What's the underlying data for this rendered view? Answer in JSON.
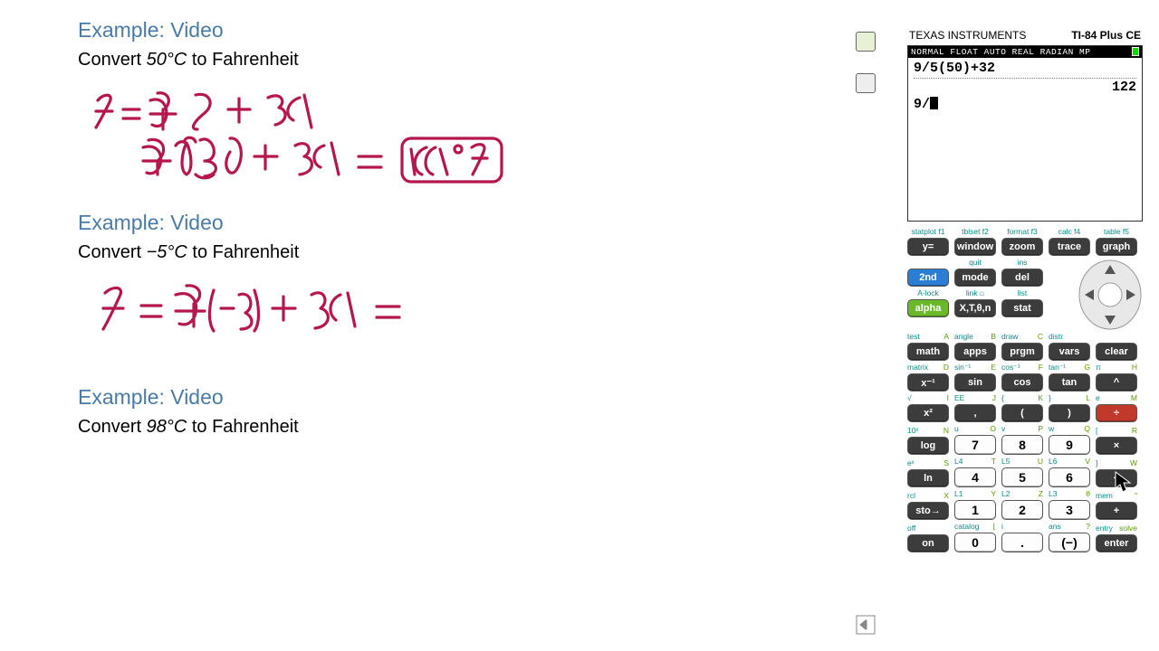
{
  "doc": {
    "ex1_title": "Example: Video",
    "ex1_prompt_a": "Convert ",
    "ex1_value": "50°C",
    "ex1_prompt_b": " to Fahrenheit",
    "ex2_title": "Example: Video",
    "ex2_prompt_a": "Convert ",
    "ex2_value": "−5°C",
    "ex2_prompt_b": " to Fahrenheit",
    "ex3_title": "Example: Video",
    "ex3_prompt_a": "Convert ",
    "ex3_value": "98°C",
    "ex3_prompt_b": " to Fahrenheit"
  },
  "calc": {
    "brand": "TEXAS INSTRUMENTS",
    "model": "TI-84 Plus CE",
    "status": "NORMAL FLOAT AUTO REAL RADIAN MP",
    "line1": "9/5(50)+32",
    "answer": "122",
    "line2": "9/",
    "f_labels": [
      "statplot  f1",
      "tblset  f2",
      "format  f3",
      "calc  f4",
      "table  f5"
    ],
    "f_keys": [
      "y=",
      "window",
      "zoom",
      "trace",
      "graph"
    ],
    "r2_labels": [
      "",
      "quit",
      "ins"
    ],
    "r2_keys": [
      "2nd",
      "mode",
      "del"
    ],
    "r3_labels": [
      "A-lock",
      "link    ⌂",
      "list"
    ],
    "r3_keys": [
      "alpha",
      "X,T,θ,n",
      "stat"
    ],
    "r4_labels": [
      [
        "test",
        "A"
      ],
      [
        "angle",
        "B"
      ],
      [
        "draw",
        "C"
      ],
      [
        "distr",
        ""
      ]
    ],
    "r4_keys": [
      "math",
      "apps",
      "prgm",
      "vars",
      "clear"
    ],
    "r5_labels": [
      [
        "matrix",
        "D"
      ],
      [
        "sin⁻¹",
        "E"
      ],
      [
        "cos⁻¹",
        "F"
      ],
      [
        "tan⁻¹",
        "G"
      ],
      [
        "π",
        "H"
      ]
    ],
    "r5_keys": [
      "x⁻¹",
      "sin",
      "cos",
      "tan",
      "^"
    ],
    "r6_labels": [
      [
        "√",
        "I"
      ],
      [
        "EE",
        "J"
      ],
      [
        "{",
        "K"
      ],
      [
        "}",
        "L"
      ],
      [
        "e",
        "M"
      ]
    ],
    "r6_keys": [
      "x²",
      ",",
      "(",
      ")",
      "÷"
    ],
    "r7_labels": [
      [
        "10ˣ",
        "N"
      ],
      [
        "u",
        "O"
      ],
      [
        "v",
        "P"
      ],
      [
        "w",
        "Q"
      ],
      [
        "[",
        "R"
      ]
    ],
    "r7_keys": [
      "log",
      "7",
      "8",
      "9",
      "×"
    ],
    "r8_labels": [
      [
        "eˣ",
        "S"
      ],
      [
        "L4",
        "T"
      ],
      [
        "L5",
        "U"
      ],
      [
        "L6",
        "V"
      ],
      [
        "]",
        "W"
      ]
    ],
    "r8_keys": [
      "ln",
      "4",
      "5",
      "6",
      "−"
    ],
    "r9_labels": [
      [
        "rcl",
        "X"
      ],
      [
        "L1",
        "Y"
      ],
      [
        "L2",
        "Z"
      ],
      [
        "L3",
        "θ"
      ],
      [
        "mem",
        "\""
      ]
    ],
    "r9_keys": [
      "sto→",
      "1",
      "2",
      "3",
      "+"
    ],
    "r10_labels": [
      [
        "off",
        ""
      ],
      [
        "catalog",
        "⌊"
      ],
      [
        "i",
        ""
      ],
      [
        "ans",
        "?"
      ],
      [
        "entry",
        "solve"
      ]
    ],
    "r10_keys": [
      "on",
      "0",
      ".",
      "(−)",
      "enter"
    ]
  }
}
